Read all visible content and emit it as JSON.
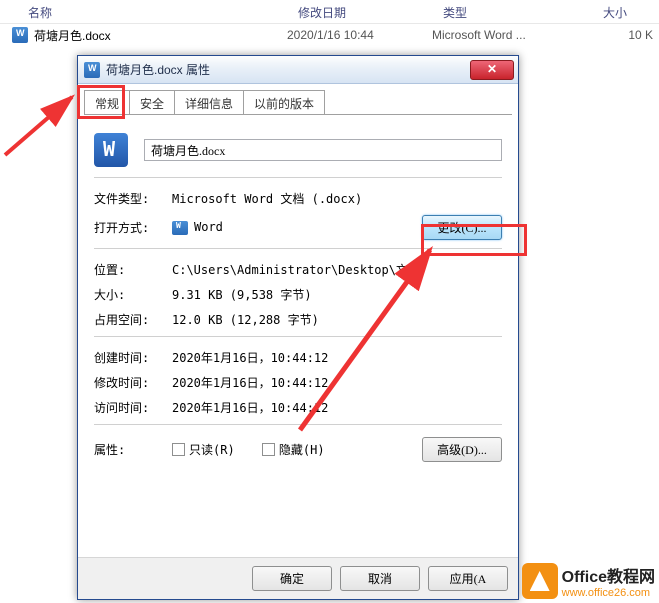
{
  "explorer": {
    "headers": {
      "name": "名称",
      "date": "修改日期",
      "type": "类型",
      "size": "大小"
    },
    "file": {
      "name": "荷塘月色.docx",
      "date": "2020/1/16 10:44",
      "type": "Microsoft Word ...",
      "size": "10 K"
    }
  },
  "dialog": {
    "title": "荷塘月色.docx 属性",
    "close": "✕",
    "tabs": [
      "常规",
      "安全",
      "详细信息",
      "以前的版本"
    ],
    "filename": "荷塘月色.docx",
    "filetype_k": "文件类型:",
    "filetype_v": "Microsoft Word 文档 (.docx)",
    "openwith_k": "打开方式:",
    "openwith_v": "Word",
    "change": "更改(C)...",
    "location_k": "位置:",
    "location_v": "C:\\Users\\Administrator\\Desktop\\文章",
    "size_k": "大小:",
    "size_v": "9.31 KB (9,538 字节)",
    "disksize_k": "占用空间:",
    "disksize_v": "12.0 KB (12,288 字节)",
    "created_k": "创建时间:",
    "created_v": "2020年1月16日，10:44:12",
    "modified_k": "修改时间:",
    "modified_v": "2020年1月16日，10:44:12",
    "accessed_k": "访问时间:",
    "accessed_v": "2020年1月16日，10:44:12",
    "attr_k": "属性:",
    "readonly": "只读(R)",
    "hidden": "隐藏(H)",
    "advanced": "高级(D)...",
    "ok": "确定",
    "cancel": "取消",
    "apply": "应用(A"
  },
  "watermark": {
    "title": "Office教程网",
    "url": "www.office26.com"
  }
}
